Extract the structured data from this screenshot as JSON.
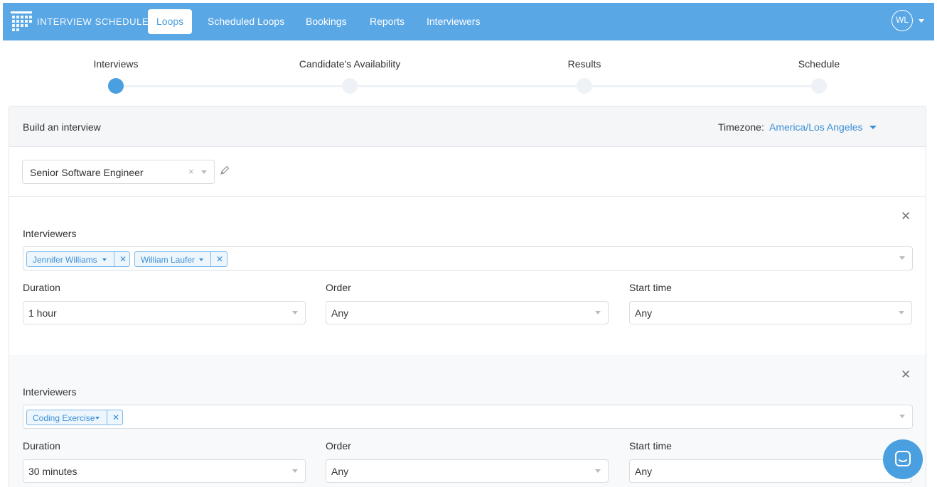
{
  "nav": {
    "brand": "INTERVIEW SCHEDULE",
    "items": [
      "Loops",
      "Scheduled Loops",
      "Bookings",
      "Reports",
      "Interviewers"
    ],
    "active_item": "Loops",
    "user_initials": "WL",
    "accent_color": "#5aa7e6"
  },
  "stepper": {
    "steps": [
      "Interviews",
      "Candidate's Availability",
      "Results",
      "Schedule"
    ],
    "current_step": "Interviews"
  },
  "builder": {
    "title": "Build an interview",
    "timezone_label": "Timezone:",
    "timezone_value": "America/Los Angeles",
    "template_value": "Senior Software Engineer",
    "clear_glyph": "×"
  },
  "interviews": [
    {
      "interviewers_label": "Interviewers",
      "interviewers": [
        "Jennifer Williams",
        "William Laufer"
      ],
      "duration_label": "Duration",
      "duration_value": "1 hour",
      "order_label": "Order",
      "order_value": "Any",
      "start_time_label": "Start time",
      "start_time_value": "Any"
    },
    {
      "interviewers_label": "Interviewers",
      "interviewers": [
        "Coding Exercise"
      ],
      "duration_label": "Duration",
      "duration_value": "30 minutes",
      "order_label": "Order",
      "order_value": "Any",
      "start_time_label": "Start time",
      "start_time_value": "Any"
    }
  ],
  "icons": {
    "logo": "calendar-grid-icon",
    "edit": "pencil-icon",
    "remove": "close-icon",
    "chat": "chat-icon"
  }
}
